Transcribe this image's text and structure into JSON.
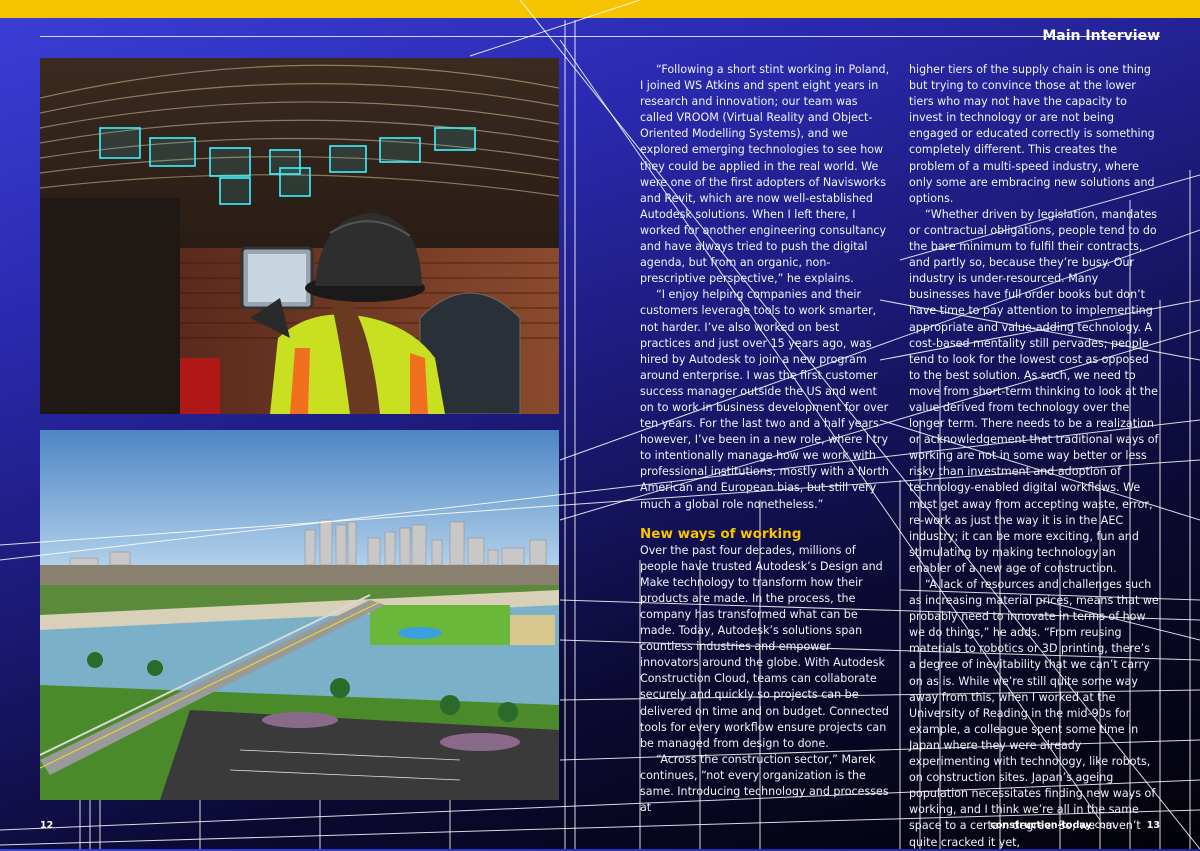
{
  "header": {
    "section": "Main Interview"
  },
  "images": {
    "top": "Worker in hard hat and hi-vis vest holding tablet with BIM overlay of ductwork",
    "bottom": "3D rendered city model with bridge, river and car park"
  },
  "article": {
    "col1": [
      "“Following a short stint working in Poland, I joined WS Atkins and spent eight years in research and innovation; our team was called VROOM (Virtual Reality and Object-Oriented Modelling Systems), and we explored emerging technologies to see how they could be applied in the real world. We were one of the first adopters of Navisworks and Revit, which are now well-established Autodesk solutions. When I left there, I worked for another engineering consultancy and have always tried to push the digital agenda, but from an organic, non-prescriptive perspective,” he explains.",
      "“I enjoy helping companies and their customers leverage tools to work smarter, not harder. I’ve also worked on best practices and just over 15 years ago, was hired by Autodesk to join a new program around enterprise. I was the first customer success manager outside the US and went on to work in business development for over ten years. For the last two and a half years however, I’ve been in a new role, where I try to intentionally manage how we work with professional institutions, mostly with a North American and European bias, but still very much a global role nonetheless.”"
    ],
    "subheading": "New ways of working",
    "col1b": [
      "Over the past four decades, millions of people have trusted Autodesk’s Design and Make technology to transform how their products are made. In the process, the company has transformed what can be made. Today, Autodesk’s solutions span countless industries and empower innovators around the globe. With Autodesk Construction Cloud, teams can collaborate securely and quickly so projects can be delivered on time and on budget. Connected tools for every workflow ensure projects can be managed from design to done.",
      "“Across the construction sector,” Marek continues, “not every organization is the same. Introducing technology and processes at"
    ],
    "col2": [
      "higher tiers of the supply chain is one thing but trying to convince those at the lower tiers who may not have the capacity to invest in technology or are not being engaged or educated correctly is something completely different. This creates the problem of a multi-speed industry, where only some are embracing new solutions and options.",
      "“Whether driven by legislation, mandates or contractual obligations, people tend to do the bare minimum to fulfil their contracts, and partly so, because they’re busy. Our industry is under-resourced. Many businesses have full order books but don’t have time to pay attention to implementing appropriate and value-adding technology. A cost-based mentality still pervades; people tend to look for the lowest cost as opposed to the best solution. As such, we need to move from short-term thinking to look at the value derived from technology over the longer term. There needs to be a realization or acknowledgement that traditional ways of working are not in some way better or less risky than investment and adoption of technology-enabled digital workflows. We must get away from accepting waste, error, re-work as just the way it is in the AEC industry; it can be more exciting, fun and stimulating by making technology an enabler of a new age of construction.",
      "“A lack of resources and challenges such as increasing material prices, means that we probably need to innovate in terms of how we do things,” he adds. “From reusing materials to robotics or 3D printing, there’s a degree of inevitability that we can’t carry on as is. While we’re still quite some way away from this, when I worked at the University of Reading in the mid-90s for example, a colleague spent some time in Japan where they were already experimenting with technology, like robots, on construction sites. Japan’s ageing population necessitates finding new ways of working, and I think we’re all in the same space to a certain degree. So, we haven’t quite cracked it yet,"
    ]
  },
  "footer": {
    "page_left": "12",
    "page_right": "13",
    "site_bold": "construction-today",
    "site_light": ".com"
  },
  "colors": {
    "accent": "#f6c400",
    "bg_top": "#3b3fd8",
    "bg_bottom": "#020208"
  }
}
